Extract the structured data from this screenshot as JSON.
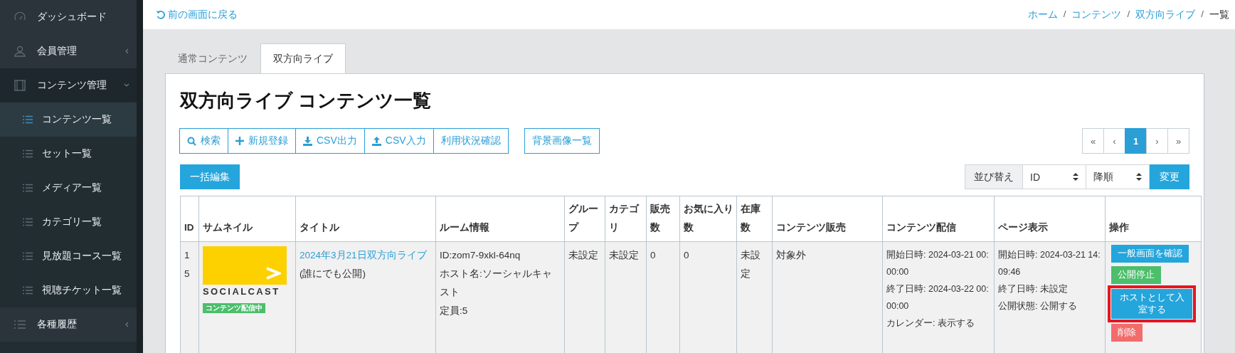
{
  "sidebar": {
    "items": [
      {
        "label": "ダッシュボード",
        "selected": false
      },
      {
        "label": "会員管理",
        "selected": false,
        "expanded": false
      },
      {
        "label": "コンテンツ管理",
        "selected": false,
        "expanded": true,
        "children": [
          {
            "label": "コンテンツ一覧",
            "selected": true
          },
          {
            "label": "セット一覧",
            "selected": false
          },
          {
            "label": "メディア一覧",
            "selected": false
          },
          {
            "label": "カテゴリ一覧",
            "selected": false
          },
          {
            "label": "見放題コース一覧",
            "selected": false
          },
          {
            "label": "視聴チケット一覧",
            "selected": false
          }
        ]
      },
      {
        "label": "各種履歴",
        "selected": false,
        "expanded": false
      }
    ]
  },
  "topbar": {
    "back_link": "前の画面に戻る",
    "breadcrumb": [
      "ホーム",
      "コンテンツ",
      "双方向ライブ",
      "一覧"
    ],
    "separator": "/"
  },
  "tabs": [
    {
      "label": "通常コンテンツ",
      "selected": false
    },
    {
      "label": "双方向ライブ",
      "selected": true
    }
  ],
  "title": "双方向ライブ コンテンツ一覧",
  "toolbar": {
    "buttons": [
      "検索",
      "新規登録",
      "CSV出力",
      "CSV入力",
      "利用状況確認"
    ],
    "extra_button": "背景画像一覧"
  },
  "pagination": [
    {
      "label": "«",
      "selected": false
    },
    {
      "label": "‹",
      "selected": false
    },
    {
      "label": "1",
      "selected": true
    },
    {
      "label": "›",
      "selected": false
    },
    {
      "label": "»",
      "selected": false
    }
  ],
  "bulk_edit_button": "一括編集",
  "sort": {
    "label": "並び替え",
    "field": "ID",
    "order": "降順",
    "button": "変更"
  },
  "table": {
    "columns": [
      "ID",
      "サムネイル",
      "タイトル",
      "ルーム情報",
      "グループ",
      "カテゴリ",
      "販売数",
      "お気に入り数",
      "在庫数",
      "コンテンツ販売",
      "コンテンツ配信",
      "ページ表示",
      "操作"
    ],
    "rows": [
      {
        "id": "15",
        "thumbnail": {
          "logo": "SOCIALCAST",
          "badge": "コンテンツ配信中"
        },
        "title": "2024年3月21日双方向ライブ",
        "visibility": "(誰にでも公開)",
        "room": [
          "ID:zom7-9xkl-64nq",
          "ホスト名:ソーシャルキャスト",
          "定員:5"
        ],
        "group": "未設定",
        "category": "未設定",
        "sales": "0",
        "favorites": "0",
        "stock": "未設定",
        "sale": "対象外",
        "delivery": [
          "開始日時:  2024-03-21 00:00:00",
          "終了日時:  2024-03-22 00:00:00",
          "カレンダー: 表示する"
        ],
        "page": [
          "開始日時:  2024-03-21 14:09:46",
          "終了日時:  未設定",
          "公開状態: 公開する"
        ],
        "actions": [
          {
            "label": "一般画面を確認",
            "kind": "info",
            "highlighted": false
          },
          {
            "label": "公開停止",
            "kind": "success",
            "highlighted": false
          },
          {
            "label": "ホストとして入室する",
            "kind": "info",
            "highlighted": true
          },
          {
            "label": "削除",
            "kind": "danger",
            "highlighted": false
          }
        ]
      }
    ]
  }
}
